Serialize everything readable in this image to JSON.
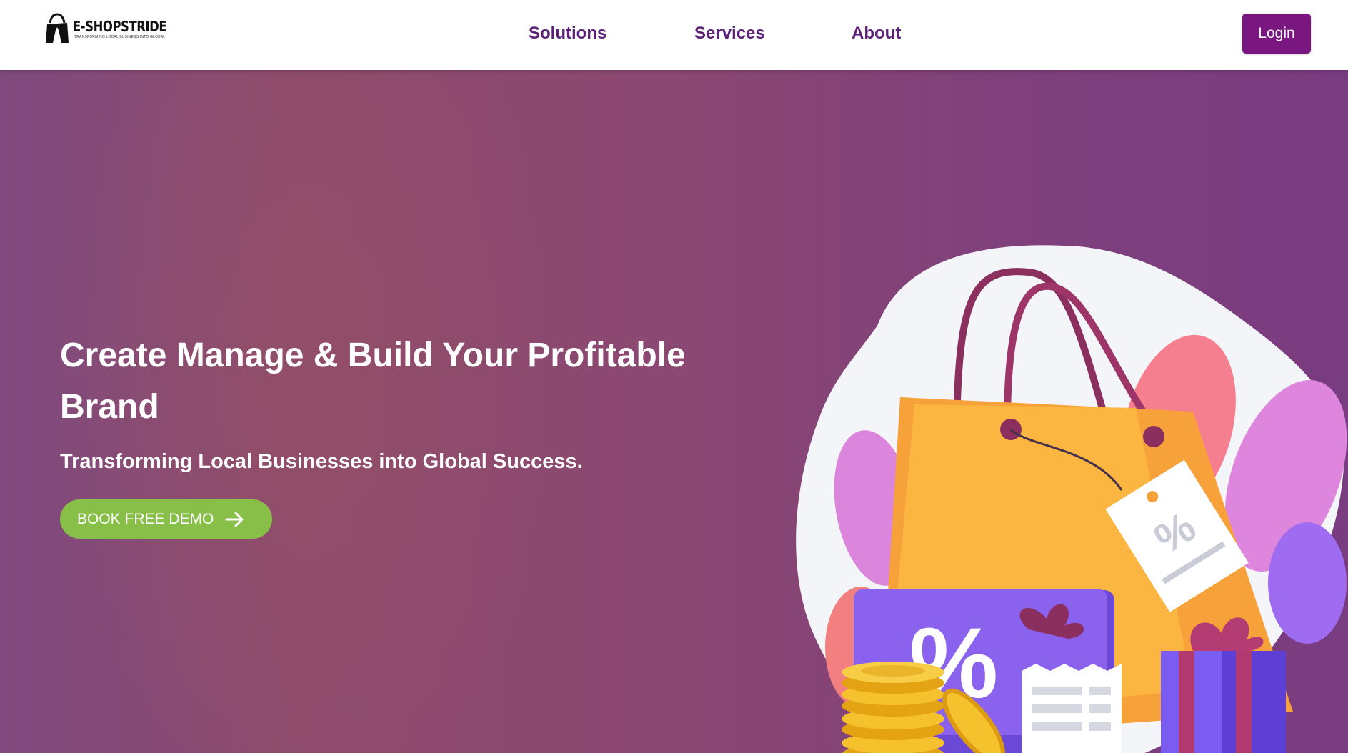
{
  "nav": {
    "brand": "E-SHOPSTRIDE",
    "tagline": "Transforming Local Business into Global",
    "links": [
      "Solutions",
      "Services",
      "About"
    ],
    "login_label": "Login"
  },
  "hero": {
    "title": "Create Manage & Build Your Profitable Brand",
    "subtitle": "Transforming Local Businesses into Global Success.",
    "cta_label": "BOOK FREE DEMO"
  },
  "colors": {
    "nav_text": "#5e2179",
    "login_bg": "#7a1680",
    "cta_bg": "#88bf48",
    "hero_bg": "#8b4872"
  },
  "icons": [
    "shopping-bag-logo-icon",
    "arrow-right-icon",
    "shopping-illustration"
  ]
}
